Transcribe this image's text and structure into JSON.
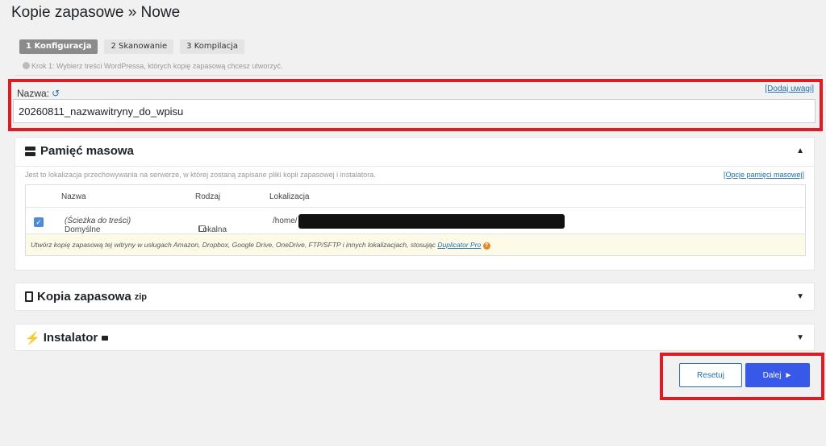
{
  "title": "Kopie zapasowe » Nowe",
  "steps": [
    {
      "label": "1 Konfiguracja"
    },
    {
      "label": "2 Skanowanie"
    },
    {
      "label": "3 Kompilacja"
    }
  ],
  "step_hint": "Krok 1: Wybierz treści WordPressa, których kopię zapasową chcesz utworzyć.",
  "name_section": {
    "label": "Nazwa:",
    "add_note": "[Dodaj uwagi]",
    "value": "20260811_nazwawitryny_do_wpisu"
  },
  "storage": {
    "title": "Pamięć masowa",
    "description": "Jest to lokalizacja przechowywania na serwerze, w której zostaną zapisane pliki kopii zapasowej i instalatora.",
    "options_link": "[Opcje pamięci masowej]",
    "columns": {
      "name": "Nazwa",
      "type": "Rodzaj",
      "location": "Lokalizacja"
    },
    "row": {
      "name": "Domyślne",
      "name_note": "(Ścieżka do treści)",
      "type": "Lokalna",
      "location": "/home/"
    },
    "promo_text": "Utwórz kopię zapasową tej witryny w usługach Amazon, Dropbox, Google Drive, OneDrive, FTP/SFTP i innych lokalizacjach, stosując",
    "promo_link": "Duplicator Pro"
  },
  "package": {
    "title": "Kopia zapasowa",
    "sup": "zip"
  },
  "installer": {
    "title": "Instalator"
  },
  "buttons": {
    "reset": "Resetuj",
    "next": "Dalej"
  },
  "colors": {
    "highlight": "#e11b22",
    "primary": "#3858e9",
    "link": "#2271b1"
  }
}
